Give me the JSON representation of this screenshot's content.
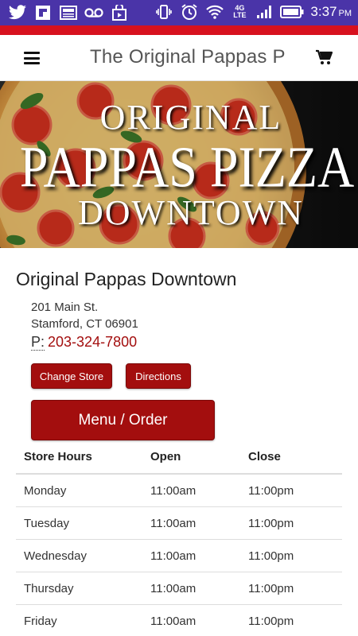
{
  "status_bar": {
    "time": "3:37",
    "ampm": "PM",
    "network_label": "4G LTE",
    "icons_left": [
      "twitter-icon",
      "flipboard-icon",
      "news-icon",
      "voicemail-icon",
      "store-icon"
    ],
    "icons_right": [
      "vibrate-icon",
      "alarm-icon",
      "wifi-icon",
      "signal-icon",
      "battery-icon"
    ]
  },
  "header": {
    "title": "The Original Pappas Pi",
    "menu_icon": "hamburger-menu-icon",
    "cart_icon": "shopping-cart-icon"
  },
  "banner": {
    "line1": "ORIGINAL",
    "line2": "PAPPAS PIZZA",
    "line3": "DOWNTOWN"
  },
  "store": {
    "name": "Original Pappas Downtown",
    "address_line1": "201 Main St.",
    "address_line2": "Stamford, CT 06901",
    "phone_prefix": "P:",
    "phone": "203-324-7800"
  },
  "buttons": {
    "change_store": "Change Store",
    "directions": "Directions",
    "menu_order": "Menu / Order"
  },
  "hours": {
    "headers": [
      "Store Hours",
      "Open",
      "Close"
    ],
    "rows": [
      {
        "day": "Monday",
        "open": "11:00am",
        "close": "11:00pm"
      },
      {
        "day": "Tuesday",
        "open": "11:00am",
        "close": "11:00pm"
      },
      {
        "day": "Wednesday",
        "open": "11:00am",
        "close": "11:00pm"
      },
      {
        "day": "Thursday",
        "open": "11:00am",
        "close": "11:00pm"
      },
      {
        "day": "Friday",
        "open": "11:00am",
        "close": "11:00pm"
      }
    ]
  },
  "colors": {
    "status_bar": "#4a34a8",
    "accent_red": "#d7111e",
    "button_red": "#a30e0e"
  }
}
